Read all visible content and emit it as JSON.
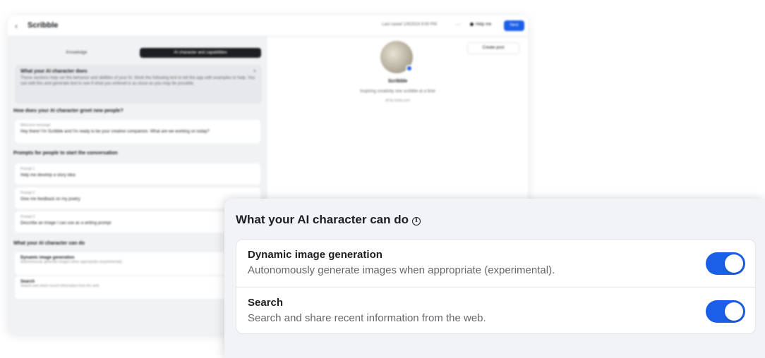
{
  "background_window": {
    "back_glyph": "‹",
    "title": "Scribble",
    "saved_status": "Last saved 1/9/2024 9:00 PM",
    "more_glyph": "···",
    "help_label": "Help me",
    "next_label": "Next",
    "tabs": [
      "Knowledge",
      "AI character and capabilities"
    ],
    "info_box": {
      "title": "What your AI character does",
      "text": "These sections help set the behavior and abilities of your AI. Work the following text to tell the app with examples to help. You can edit this and generate text to see if what you entered is as close as you may be possible.",
      "close_glyph": "×"
    },
    "greeting_section": "How does your AI character greet new people?",
    "greeting_card": {
      "label": "Welcome message",
      "value": "Hey there! I'm Scribble and I'm ready to be your creative companion. What are we working on today?"
    },
    "prompts_section": "Prompts for people to start the conversation",
    "prompts": [
      {
        "label": "Prompt 1",
        "value": "Help me develop a story idea"
      },
      {
        "label": "Prompt 2",
        "value": "Give me feedback on my poetry"
      },
      {
        "label": "Prompt 3",
        "value": "Describe an image I can use as a writing prompt"
      }
    ],
    "can_do_section": "What your AI character can do",
    "can_do_items": [
      {
        "label": "Dynamic image generation",
        "value": "Autonomously generate images when appropriate (experimental)."
      },
      {
        "label": "Search",
        "value": "Search and share recent information from the web."
      }
    ],
    "profile": {
      "create_post_label": "Create post",
      "name": "Scribble",
      "tagline": "Inspiring creativity one scribble at a time",
      "meta": "AI by meta.com"
    }
  },
  "panel": {
    "title": "What your AI character can do",
    "info_icon_glyph": "i",
    "capabilities": [
      {
        "title": "Dynamic image generation",
        "description": "Autonomously generate images when appropriate (experimental).",
        "enabled": true
      },
      {
        "title": "Search",
        "description": "Search and share recent information from the web.",
        "enabled": true
      }
    ]
  },
  "colors": {
    "accent": "#1b5ee8",
    "panel_bg": "#f1f3f6",
    "secondary_text": "#65676b"
  }
}
